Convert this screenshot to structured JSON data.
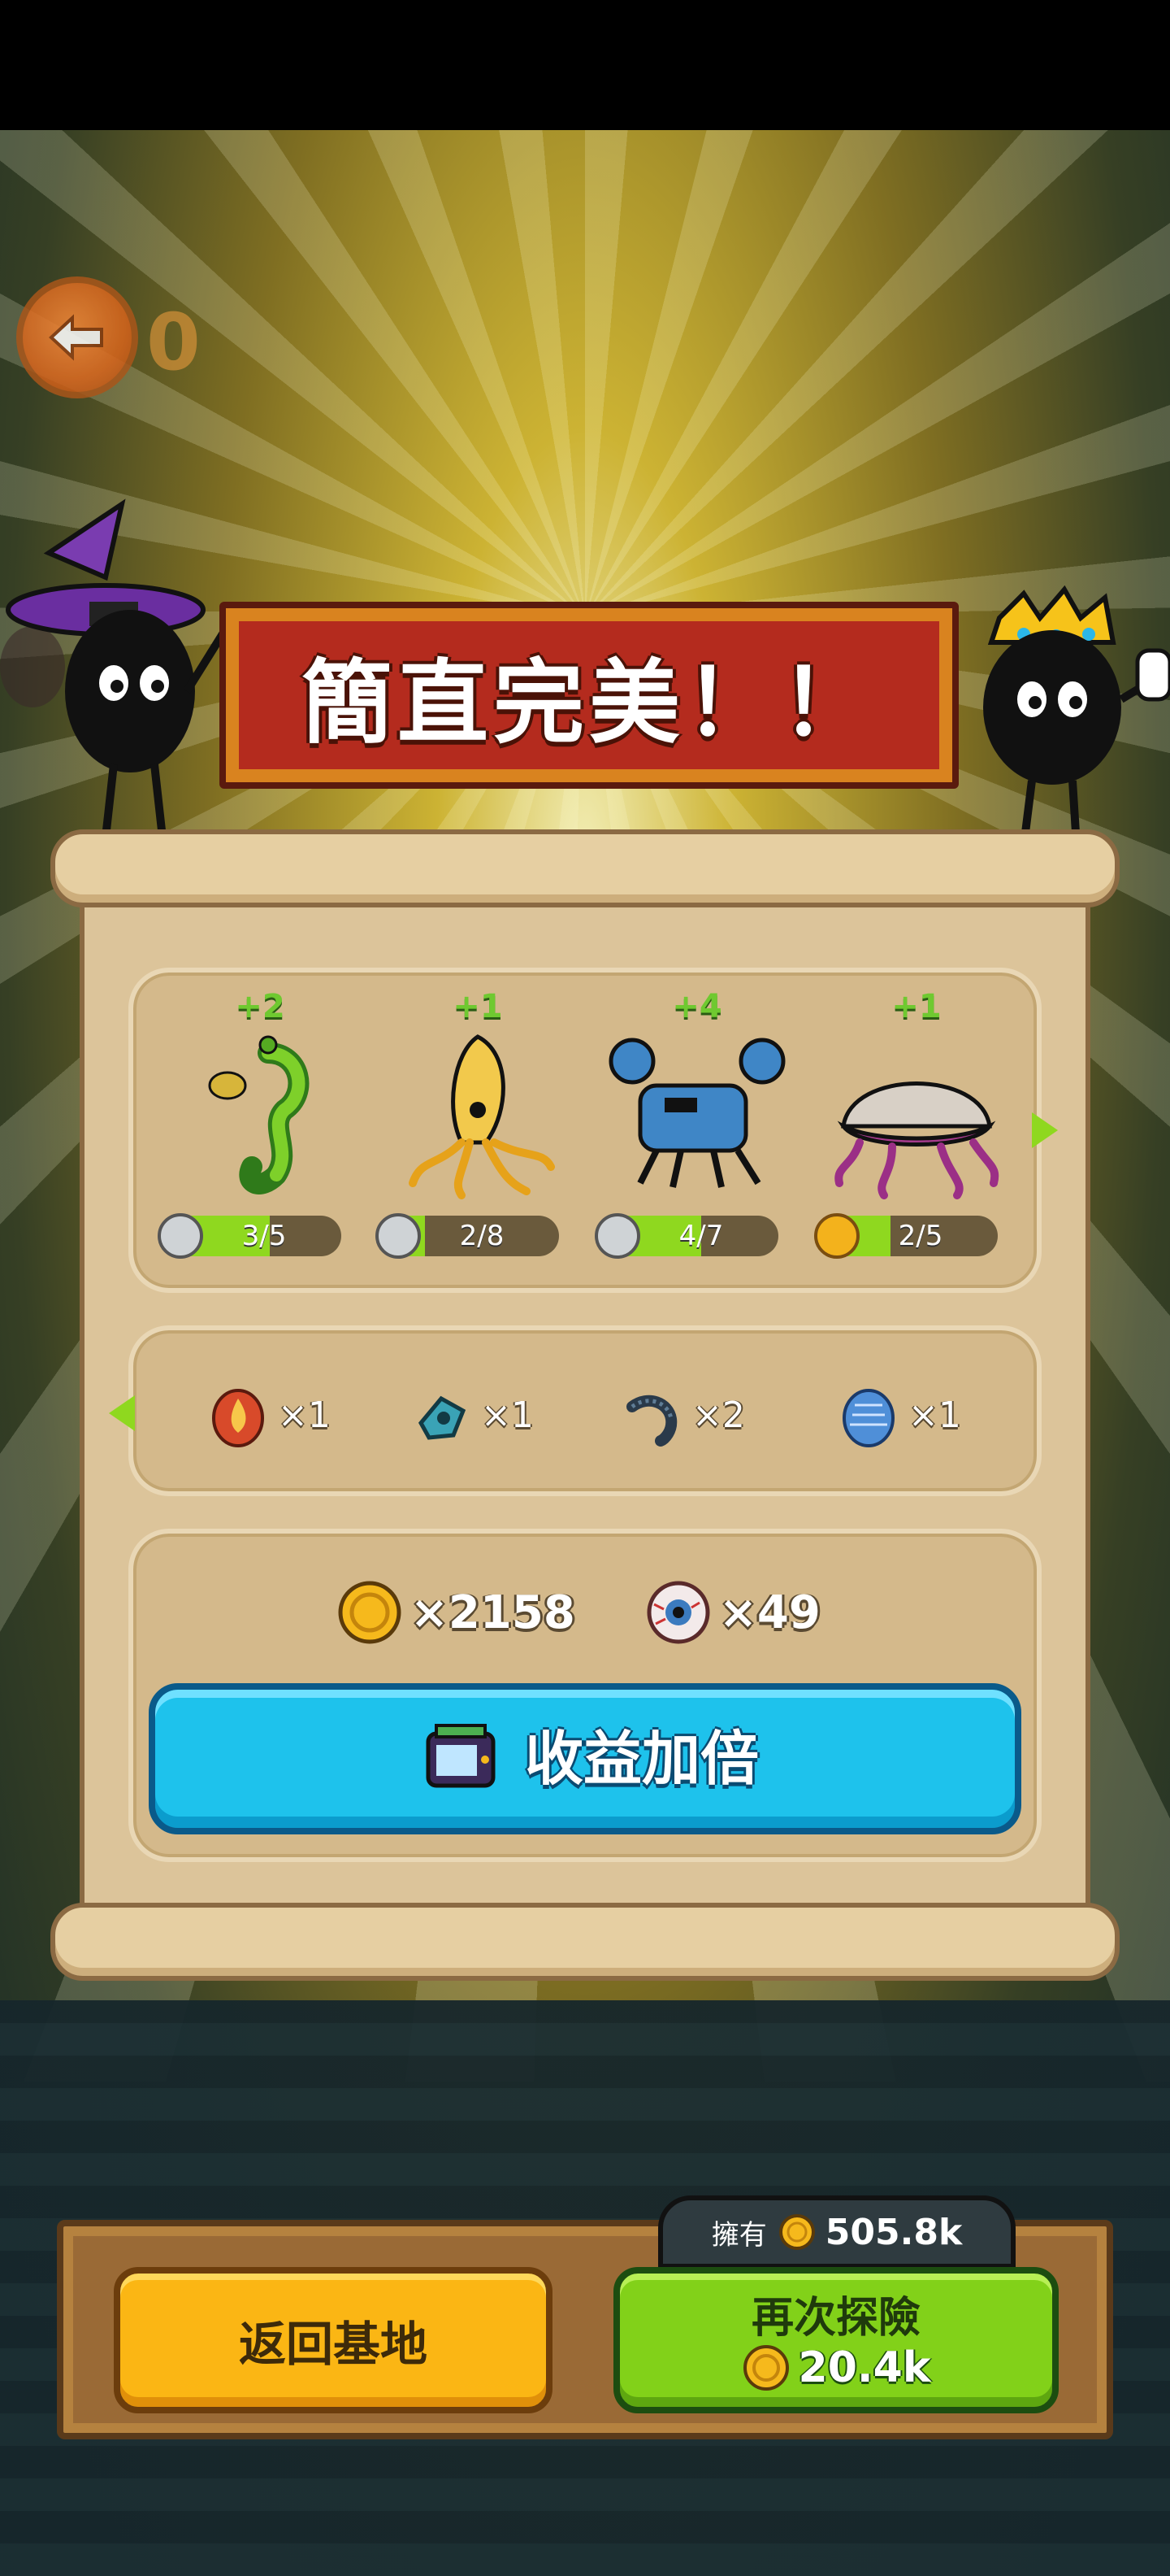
{
  "back": {
    "count": "0"
  },
  "banner": {
    "title": "簡直完美！！"
  },
  "creatures": [
    {
      "plus": "+2",
      "progress": "3/5",
      "ratio": 0.6,
      "badge": "silver"
    },
    {
      "plus": "+1",
      "progress": "2/8",
      "ratio": 0.25,
      "badge": "silver"
    },
    {
      "plus": "+4",
      "progress": "4/7",
      "ratio": 0.57,
      "badge": "silver"
    },
    {
      "plus": "+1",
      "progress": "2/5",
      "ratio": 0.4,
      "badge": "gold"
    }
  ],
  "items": [
    {
      "icon": "fire-egg-icon",
      "count": "×1"
    },
    {
      "icon": "blue-relic-icon",
      "count": "×1"
    },
    {
      "icon": "spiky-worm-icon",
      "count": "×2"
    },
    {
      "icon": "blue-egg-icon",
      "count": "×1"
    }
  ],
  "rewards": {
    "coins": "×2158",
    "eyes": "×49"
  },
  "double_button": {
    "label": "收益加倍"
  },
  "owned": {
    "label": "擁有",
    "value": "505.8k"
  },
  "return_button": {
    "label": "返回基地"
  },
  "explore_button": {
    "label": "再次探險",
    "cost": "20.4k"
  },
  "colors": {
    "accent_blue": "#1ec2ec",
    "accent_green": "#82d119",
    "accent_yellow": "#fbb614",
    "banner_red": "#b42b1e"
  }
}
